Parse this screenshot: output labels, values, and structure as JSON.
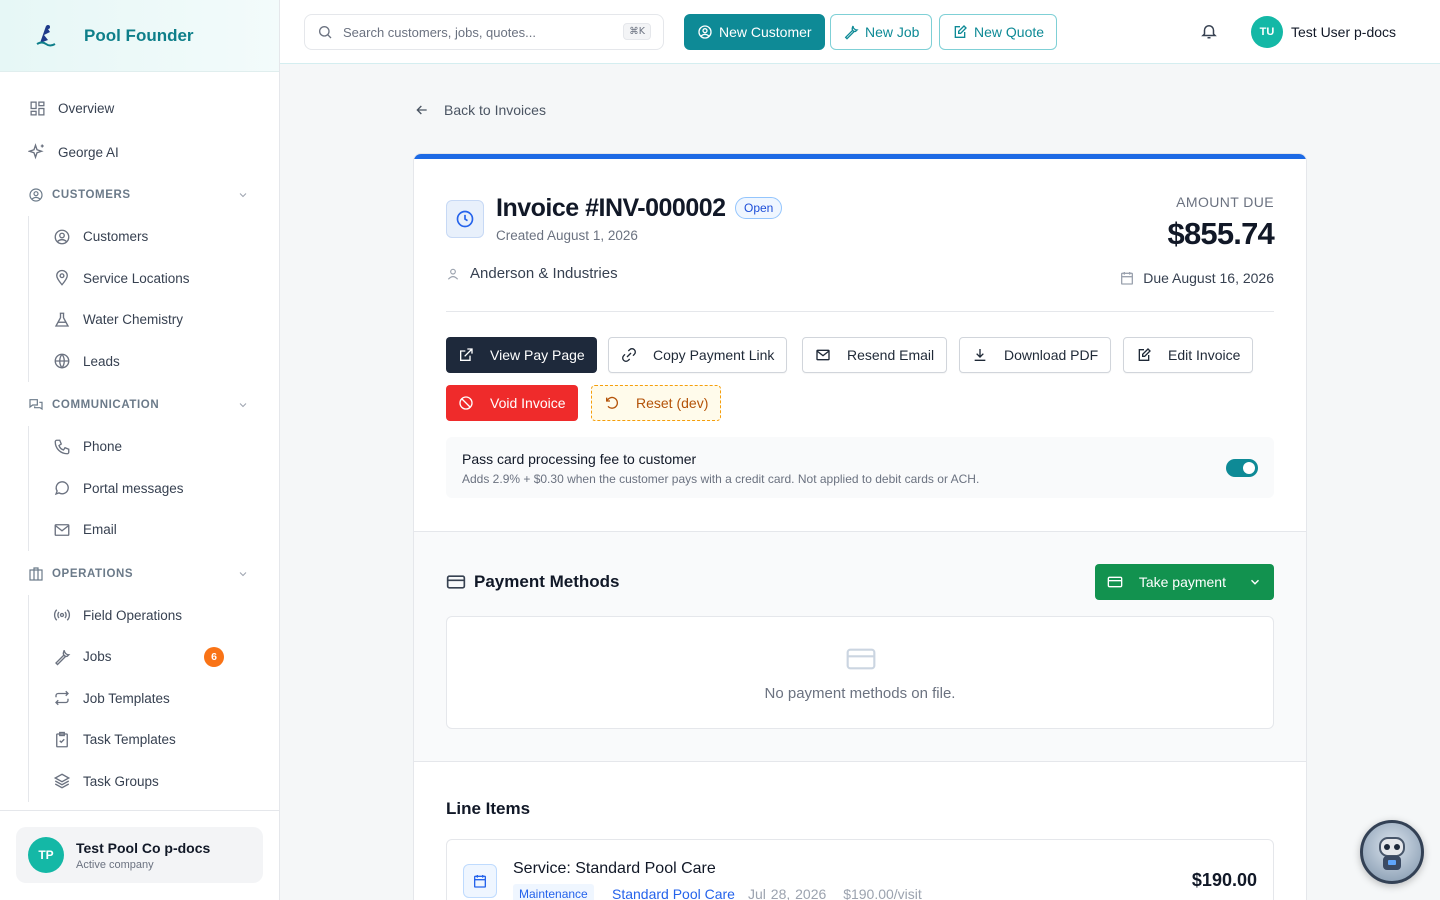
{
  "brand": {
    "name": "Pool Founder"
  },
  "sidebar": {
    "top_items": [
      {
        "label": "Overview",
        "icon": "grid-icon"
      },
      {
        "label": "George AI",
        "icon": "sparkles-icon"
      }
    ],
    "sections": [
      {
        "title": "CUSTOMERS",
        "items": [
          "Customers",
          "Service Locations",
          "Water Chemistry",
          "Leads"
        ]
      },
      {
        "title": "COMMUNICATION",
        "items": [
          "Phone",
          "Portal messages",
          "Email"
        ]
      },
      {
        "title": "OPERATIONS",
        "items": [
          "Field Operations",
          "Jobs",
          "Job Templates",
          "Task Templates",
          "Task Groups"
        ]
      }
    ],
    "jobs_badge": "6",
    "company": {
      "initials": "TP",
      "name": "Test Pool Co p-docs",
      "status": "Active company"
    }
  },
  "topbar": {
    "search_placeholder": "Search customers, jobs, quotes...",
    "search_shortcut": "⌘K",
    "new_customer": "New Customer",
    "new_job": "New Job",
    "new_quote": "New Quote",
    "user_initials": "TU",
    "user_name": "Test User p-docs"
  },
  "main": {
    "back_label": "Back to Invoices",
    "invoice": {
      "title": "Invoice #INV-000002",
      "status": "Open",
      "created": "Created August 1, 2026",
      "customer": "Anderson & Industries",
      "amount_label": "AMOUNT DUE",
      "amount": "$855.74",
      "due": "Due August 16, 2026"
    },
    "actions": {
      "view_pay_page": "View Pay Page",
      "copy_payment_link": "Copy Payment Link",
      "resend_email": "Resend Email",
      "download_pdf": "Download PDF",
      "edit_invoice": "Edit Invoice",
      "void_invoice": "Void Invoice",
      "reset_dev": "Reset (dev)"
    },
    "fee": {
      "title": "Pass card processing fee to customer",
      "description": "Adds 2.9% + $0.30 when the customer pays with a credit card. Not applied to debit cards or ACH.",
      "enabled": true
    },
    "payment_methods": {
      "title": "Payment Methods",
      "take_payment": "Take payment",
      "empty": "No payment methods on file."
    },
    "line_items": {
      "title": "Line Items",
      "items": [
        {
          "name": "Service: Standard Pool Care",
          "tag": "Maintenance",
          "link": "Standard Pool Care",
          "date": "Jul 28, 2026",
          "rate": "$190.00/visit",
          "price": "$190.00"
        }
      ]
    }
  },
  "colors": {
    "accent": "#0e8a96",
    "primary_bar": "#1d6ae5",
    "danger": "#ef2b2b",
    "success": "#12924f"
  }
}
